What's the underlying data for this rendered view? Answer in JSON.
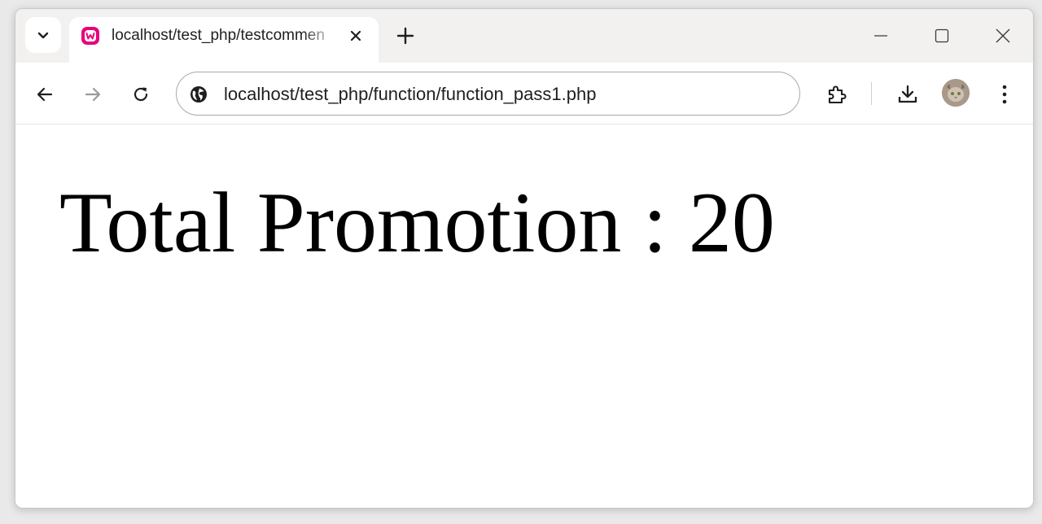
{
  "browser": {
    "tab": {
      "title": "localhost/test_php/testcommen",
      "favicon": "wampserver-icon",
      "favicon_color": "#e5007e"
    },
    "address_bar": {
      "url": "localhost/test_php/function/function_pass1.php",
      "site_info_icon": "globe-icon"
    },
    "toolbar_icons": [
      "back-icon",
      "forward-icon",
      "reload-icon",
      "extensions-icon",
      "download-icon",
      "profile-avatar",
      "menu-icon"
    ],
    "window_controls": [
      "minimize-icon",
      "maximize-icon",
      "close-icon"
    ]
  },
  "page": {
    "heading": "Total Promotion : 20"
  },
  "colors": {
    "tabstrip_bg": "#f2f1f0",
    "text": "#1f1f1f",
    "page_bg": "#ffffff"
  }
}
